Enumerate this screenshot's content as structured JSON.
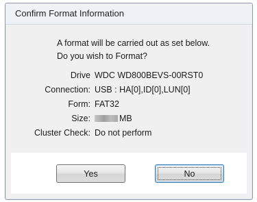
{
  "window": {
    "title": "Confirm Format Information"
  },
  "prompt": {
    "line1": "A format will be carried out as set below.",
    "line2": "Do you wish to Format?"
  },
  "fields": [
    {
      "label": "Drive",
      "value": "WDC WD800BEVS-00RST0"
    },
    {
      "label": "Connection:",
      "value": "USB : HA[0],ID[0],LUN[0]"
    },
    {
      "label": "Form:",
      "value": "FAT32"
    },
    {
      "label": "Size:",
      "value": "MB"
    },
    {
      "label": "Cluster Check:",
      "value": "Do not perform"
    }
  ],
  "buttons": {
    "yes_label": "Yes",
    "no_label": "No"
  }
}
